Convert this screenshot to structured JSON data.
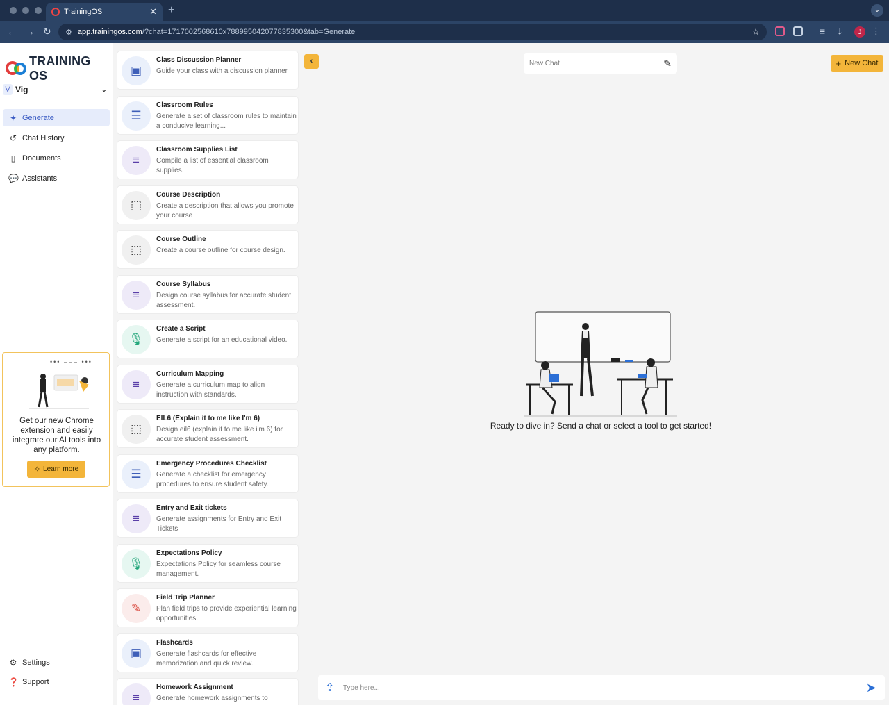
{
  "browser": {
    "tab_title": "TrainingOS",
    "url_host": "app.trainingos.com",
    "url_path": "/?chat=1717002568610x788995042077835300&tab=Generate",
    "profile_initial": "J"
  },
  "sidebar": {
    "logo_text": "TRAINING OS",
    "workspace_initial": "V",
    "workspace_name": "Vig",
    "nav": [
      {
        "label": "Generate",
        "icon": "magic-wand-icon"
      },
      {
        "label": "Chat History",
        "icon": "history-icon"
      },
      {
        "label": "Documents",
        "icon": "document-icon"
      },
      {
        "label": "Assistants",
        "icon": "chat-bubbles-icon"
      }
    ],
    "promo": {
      "dots": "••• ––– •••",
      "text": "Get our new Chrome extension and easily integrate our AI tools into any platform.",
      "button": "Learn more"
    },
    "bottom": [
      {
        "label": "Settings",
        "icon": "gear-icon"
      },
      {
        "label": "Support",
        "icon": "help-icon"
      }
    ]
  },
  "tools": [
    {
      "title": "Class Discussion Planner",
      "desc": "Guide your class with a discussion planner",
      "icon": "image-icon",
      "color": "blue"
    },
    {
      "title": "Classroom Rules",
      "desc": "Generate a set of classroom rules to maintain a conducive learning...",
      "icon": "lines-icon",
      "color": "blue"
    },
    {
      "title": "Classroom Supplies List",
      "desc": "Compile a list of essential classroom supplies.",
      "icon": "align-center-icon",
      "color": "purple"
    },
    {
      "title": "Course Description",
      "desc": "Create a description that allows you promote your course",
      "icon": "pointer-icon",
      "color": "gray"
    },
    {
      "title": "Course Outline",
      "desc": "Create a course outline for course design.",
      "icon": "pointer-icon",
      "color": "gray"
    },
    {
      "title": "Course Syllabus",
      "desc": "Design course syllabus for accurate student assessment.",
      "icon": "align-center-icon",
      "color": "purple"
    },
    {
      "title": "Create a Script",
      "desc": "Generate a script for an educational video.",
      "icon": "microphone-icon",
      "color": "green"
    },
    {
      "title": "Curriculum Mapping",
      "desc": "Generate a curriculum map to align instruction with standards.",
      "icon": "align-center-icon",
      "color": "purple"
    },
    {
      "title": "EIL6 (Explain it to me like I'm 6)",
      "desc": "Design eil6 (explain it to me like i'm 6) for accurate student assessment.",
      "icon": "pointer-icon",
      "color": "gray"
    },
    {
      "title": "Emergency Procedures Checklist",
      "desc": "Generate a checklist for emergency procedures to ensure student safety.",
      "icon": "lines-icon",
      "color": "blue"
    },
    {
      "title": "Entry and Exit tickets",
      "desc": "Generate assignments for Entry and Exit Tickets",
      "icon": "align-center-icon",
      "color": "purple"
    },
    {
      "title": "Expectations Policy",
      "desc": "Expectations Policy for seamless course management.",
      "icon": "microphone-icon",
      "color": "green"
    },
    {
      "title": "Field Trip Planner",
      "desc": "Plan field trips to provide experiential learning opportunities.",
      "icon": "pen-icon",
      "color": "red"
    },
    {
      "title": "Flashcards",
      "desc": "Generate flashcards for effective memorization and quick review.",
      "icon": "image-icon",
      "color": "blue"
    },
    {
      "title": "Homework Assignment",
      "desc": "Generate homework assignments to",
      "icon": "align-center-icon",
      "color": "purple"
    }
  ],
  "main": {
    "chat_name_placeholder": "New Chat",
    "new_chat_button": "New Chat",
    "empty_message": "Ready to dive in? Send a chat or select a tool to get started!",
    "input_placeholder": "Type here..."
  }
}
